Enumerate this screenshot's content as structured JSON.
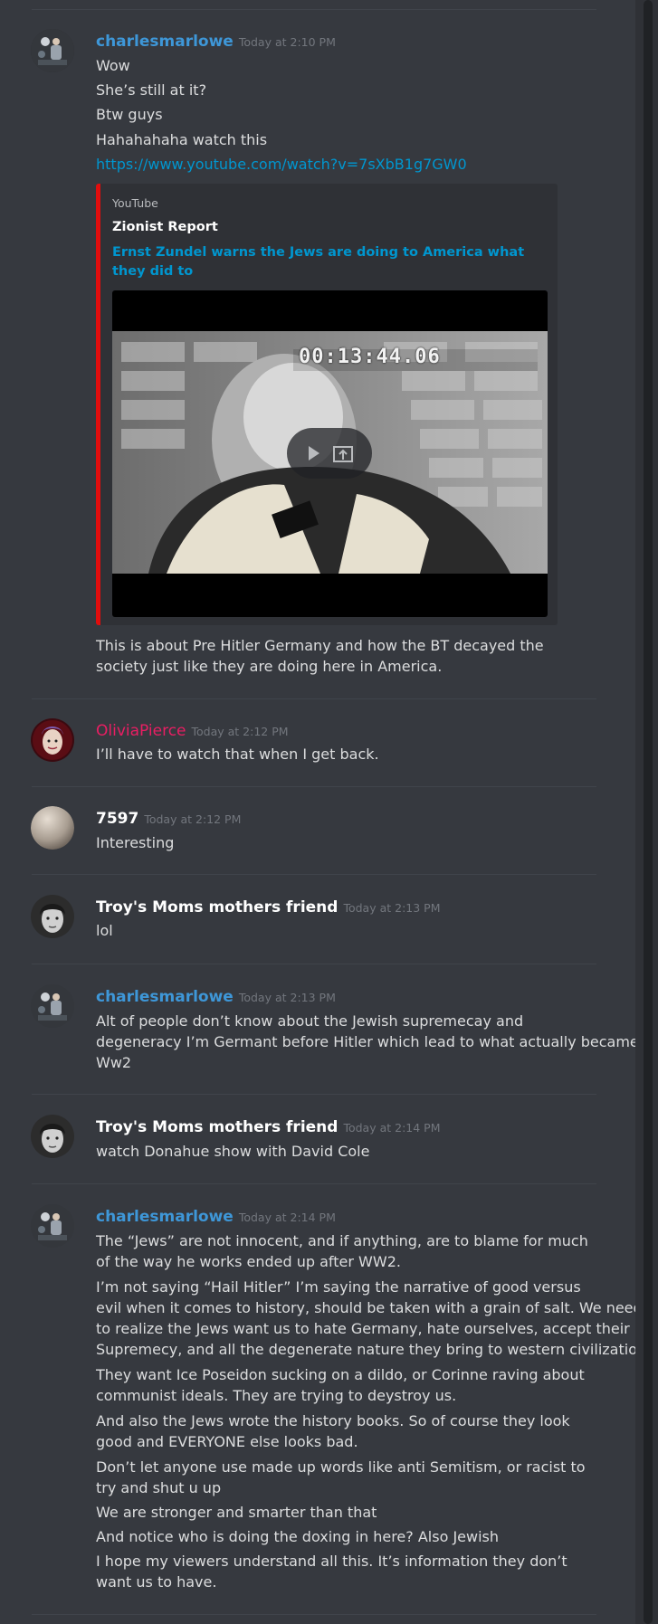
{
  "messages": [
    {
      "author": "charlesmarlowe",
      "author_color": "#3e97d8",
      "timestamp": "Today at 2:10 PM",
      "lines": [
        "Wow",
        "She’s still at it?",
        "Btw guys",
        "Hahahahaha watch this"
      ],
      "link": "https://www.youtube.com/watch?v=7sXbB1g7GW0",
      "embed": {
        "provider": "YouTube",
        "author": "Zionist Report",
        "title_line1": "Ernst Zundel warns the Jews are doing to America what they did to",
        "title_line2": "...",
        "video_timecode": "00:13:44.06",
        "accent_color": "#e10d0d"
      },
      "after_lines": [
        "This is about Pre Hitler Germany and how the BT decayed the",
        "society just like they are doing here in America."
      ]
    },
    {
      "author": "OliviaPierce",
      "author_color": "#e91e63",
      "timestamp": "Today at 2:12 PM",
      "lines": [
        "I’ll have to watch that when I get back."
      ]
    },
    {
      "author": "7597",
      "author_color": "#ffffff",
      "timestamp": "Today at 2:12 PM",
      "lines": [
        "Interesting"
      ]
    },
    {
      "author": "Troy's Moms mothers friend",
      "author_color": "#ffffff",
      "timestamp": "Today at 2:13 PM",
      "lines": [
        "lol"
      ]
    },
    {
      "author": "charlesmarlowe",
      "author_color": "#3e97d8",
      "timestamp": "Today at 2:13 PM",
      "lines": [
        "Alt of people don’t know about the Jewish supremecay and",
        "degeneracy I’m Germant before Hitler which lead to what actually became",
        "Ww2"
      ]
    },
    {
      "author": "Troy's Moms mothers friend",
      "author_color": "#ffffff",
      "timestamp": "Today at 2:14 PM",
      "lines": [
        "watch Donahue show with David Cole"
      ]
    },
    {
      "author": "charlesmarlowe",
      "author_color": "#3e97d8",
      "timestamp": "Today at 2:14 PM",
      "lines": [
        "The “Jews” are not innocent, and if anything, are to blame for much",
        "of the way he works ended up after WW2.",
        "I’m not saying “Hail Hitler” I’m saying the narrative of good versus",
        "evil when it comes to history, should be taken with a grain of salt. We need",
        "to realize the Jews want us to hate Germany, hate ourselves, accept their",
        "Supremecy, and all the degenerate nature they bring to western civilization",
        "They want Ice Poseidon sucking on a dildo, or Corinne raving about",
        "communist ideals. They are trying to deystroy us.",
        "And also the Jews wrote the history books. So of course they look",
        "good and EVERYONE else looks bad.",
        "Don’t let anyone use made up words like anti Semitism, or racist to",
        "try and shut u up",
        "We are stronger and smarter than that",
        "And notice who is doing the doxing in here? Also Jewish",
        "I hope my viewers understand all this. It’s information they don’t",
        "want us to have."
      ]
    }
  ]
}
